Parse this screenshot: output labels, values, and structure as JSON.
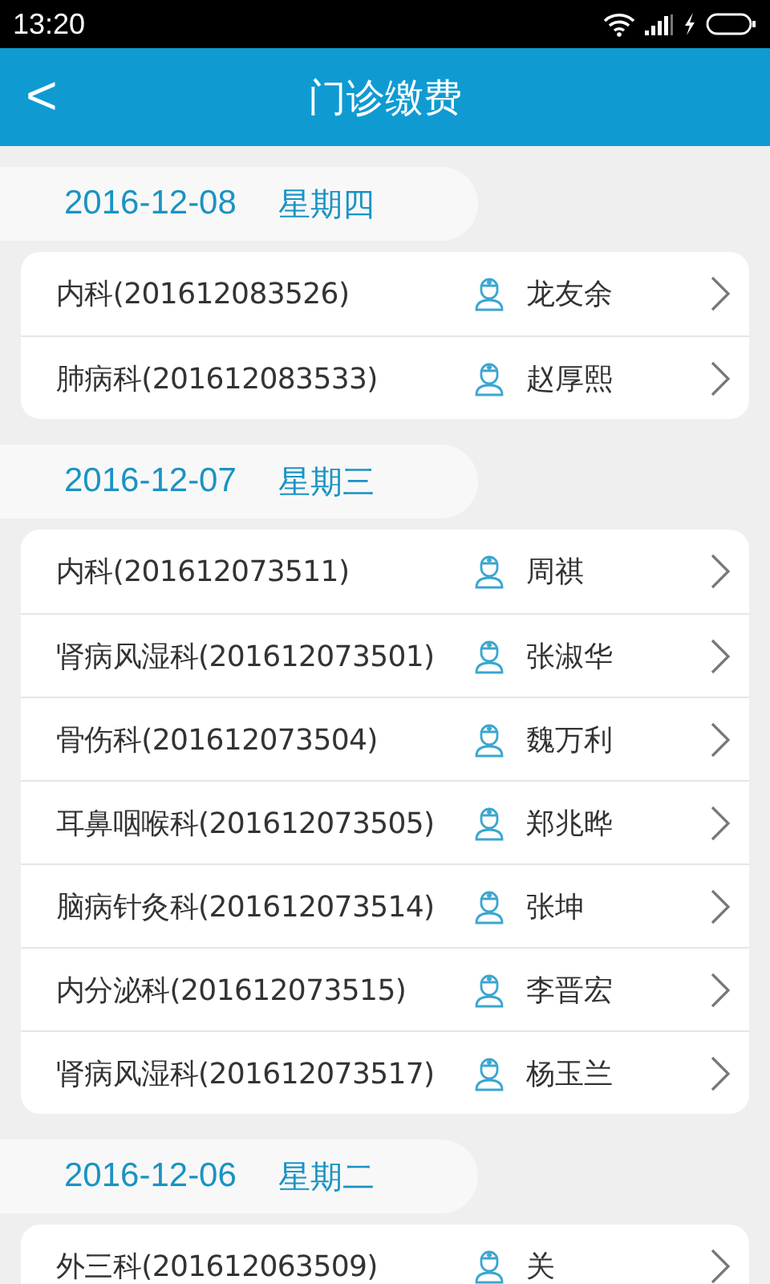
{
  "status_bar": {
    "time": "13:20"
  },
  "header": {
    "back": "<",
    "title": "门诊缴费"
  },
  "groups": [
    {
      "date": "2016-12-08",
      "weekday": "星期四",
      "items": [
        {
          "dept": "内科(201612083526)",
          "name": "龙友余"
        },
        {
          "dept": "肺病科(201612083533)",
          "name": "赵厚熙"
        }
      ]
    },
    {
      "date": "2016-12-07",
      "weekday": "星期三",
      "items": [
        {
          "dept": "内科(201612073511)",
          "name": "周祺"
        },
        {
          "dept": "肾病风湿科(201612073501)",
          "name": "张淑华"
        },
        {
          "dept": "骨伤科(201612073504)",
          "name": "魏万利"
        },
        {
          "dept": "耳鼻咽喉科(201612073505)",
          "name": "郑兆晔"
        },
        {
          "dept": "脑病针灸科(201612073514)",
          "name": "张坤"
        },
        {
          "dept": "内分泌科(201612073515)",
          "name": "李晋宏"
        },
        {
          "dept": "肾病风湿科(201612073517)",
          "name": "杨玉兰"
        }
      ]
    },
    {
      "date": "2016-12-06",
      "weekday": "星期二",
      "items": [
        {
          "dept": "外三科(201612063509)",
          "name": "关"
        }
      ]
    }
  ]
}
